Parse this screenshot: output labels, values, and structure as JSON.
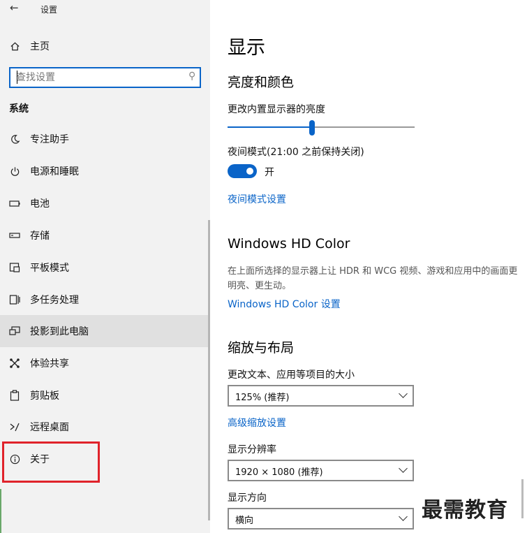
{
  "window": {
    "back_glyph": "←",
    "title": "设置"
  },
  "sidebar": {
    "home_label": "主页",
    "search_placeholder": "查找设置",
    "section_title": "系统",
    "items": [
      {
        "label": "专注助手",
        "icon": "moon-icon"
      },
      {
        "label": "电源和睡眠",
        "icon": "power-icon"
      },
      {
        "label": "电池",
        "icon": "battery-icon"
      },
      {
        "label": "存储",
        "icon": "storage-icon"
      },
      {
        "label": "平板模式",
        "icon": "tablet-mode-icon"
      },
      {
        "label": "多任务处理",
        "icon": "multitasking-icon"
      },
      {
        "label": "投影到此电脑",
        "icon": "project-icon"
      },
      {
        "label": "体验共享",
        "icon": "shared-experiences-icon"
      },
      {
        "label": "剪贴板",
        "icon": "clipboard-icon"
      },
      {
        "label": "远程桌面",
        "icon": "remote-desktop-icon"
      },
      {
        "label": "关于",
        "icon": "info-icon"
      }
    ],
    "selected_item": "投影到此电脑",
    "highlighted_item": "关于",
    "highlight_color": "#e0232b"
  },
  "main": {
    "page_title": "显示",
    "brightness": {
      "heading": "亮度和颜色",
      "slider_label": "更改内置显示器的亮度",
      "brightness_fraction": 0.45,
      "night_light_label": "夜间模式(21:00 之前保持关闭)",
      "toggle_state": "开",
      "night_light_link": "夜间模式设置"
    },
    "hd_color": {
      "heading": "Windows HD Color",
      "description": "在上面所选择的显示器上让 HDR 和 WCG 视频、游戏和应用中的画面更明亮、更生动。",
      "link": "Windows HD Color 设置"
    },
    "scale_layout": {
      "heading": "缩放与布局",
      "scale_label": "更改文本、应用等项目的大小",
      "scale_value": "125% (推荐)",
      "advanced_link": "高级缩放设置",
      "resolution_label": "显示分辨率",
      "resolution_value": "1920 × 1080 (推荐)",
      "orientation_label": "显示方向",
      "orientation_value": "横向"
    }
  },
  "watermark": "最需教育",
  "colors": {
    "accent": "#0a64c8",
    "sidebar_bg": "#f2f2f2",
    "selected_bg": "#e0e0e0"
  }
}
